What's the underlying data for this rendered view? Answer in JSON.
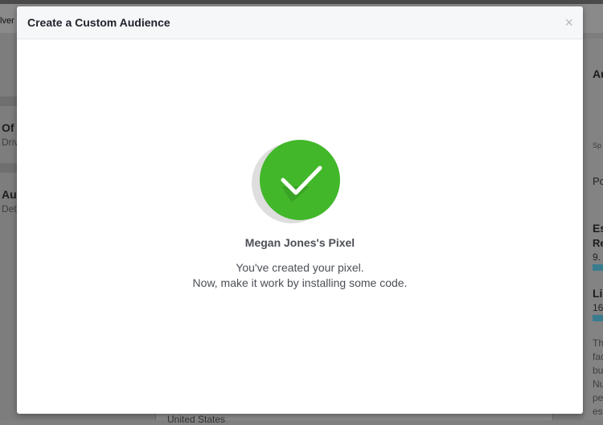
{
  "background": {
    "left_items": [
      {
        "title": "Of",
        "sub": "Driv"
      },
      {
        "title": "Au",
        "sub": "Det"
      }
    ],
    "top_left_fragment": "lver",
    "right_fragments": {
      "au": "Au",
      "sp": "Sp",
      "po": "Po",
      "es": "Es",
      "re": "Re",
      "n9": "9.",
      "li": "Li",
      "n16": "16",
      "text_lines": [
        "Th",
        "fac",
        "bu",
        "Nu",
        "pe",
        "es"
      ]
    },
    "bottom_fragment": "United States"
  },
  "modal": {
    "title": "Create a Custom Audience",
    "close_symbol": "×",
    "pixel_name": "Megan Jones's Pixel",
    "message_line1": "You've created your pixel.",
    "message_line2": "Now, make it work by installing some code.",
    "success_icon": "checkmark-icon",
    "success_color": "#42b72a"
  }
}
